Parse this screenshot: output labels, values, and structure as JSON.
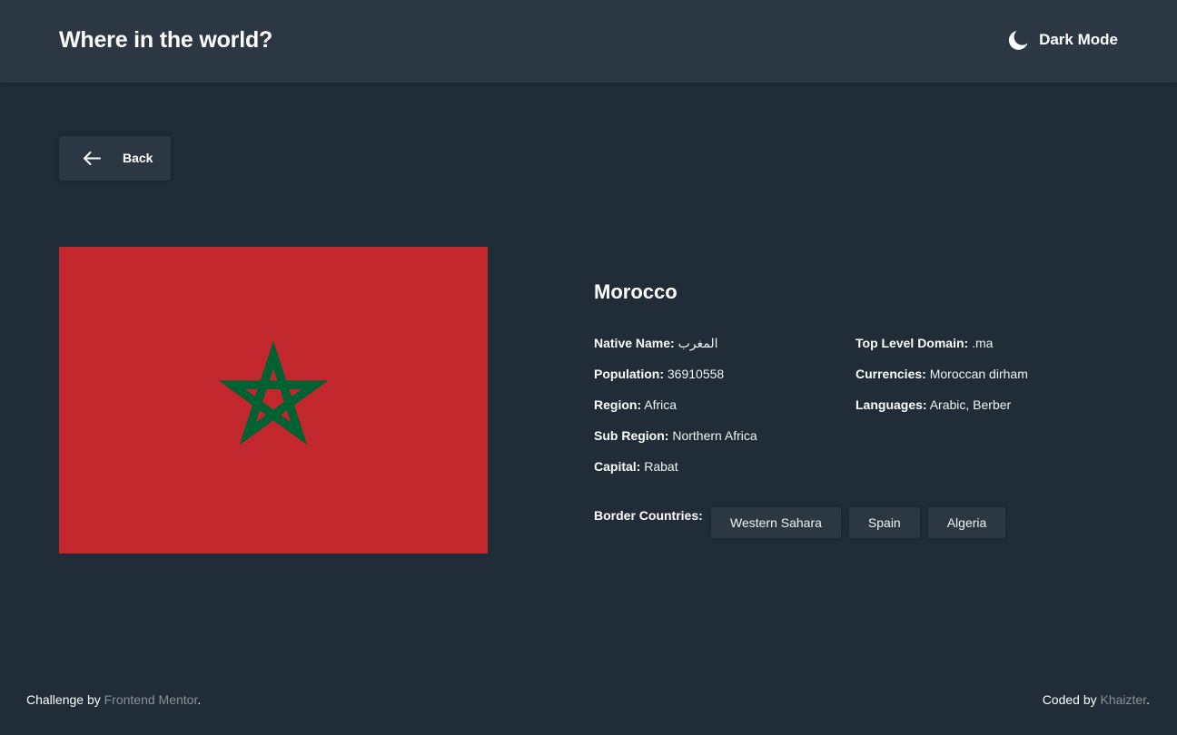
{
  "header": {
    "title": "Where in the world?",
    "theme_label": "Dark Mode",
    "theme_icon": "moon-icon"
  },
  "back_button": {
    "label": "Back",
    "icon": "arrow-left-icon"
  },
  "country": {
    "name": "Morocco",
    "flag_colors": {
      "field": "#c1272d",
      "star": "#006233"
    },
    "left_details": [
      {
        "label": "Native Name:",
        "value": "المغرب"
      },
      {
        "label": "Population:",
        "value": "36910558"
      },
      {
        "label": "Region:",
        "value": "Africa"
      },
      {
        "label": "Sub Region:",
        "value": "Northern Africa"
      },
      {
        "label": "Capital:",
        "value": "Rabat"
      }
    ],
    "right_details": [
      {
        "label": "Top Level Domain:",
        "value": ".ma"
      },
      {
        "label": "Currencies:",
        "value": "Moroccan dirham"
      },
      {
        "label": "Languages:",
        "value": "Arabic, Berber"
      }
    ],
    "border_label": "Border Countries:",
    "borders": [
      "Western Sahara",
      "Spain",
      "Algeria"
    ]
  },
  "footer": {
    "challenge_prefix": "Challenge by ",
    "challenge_link": "Frontend Mentor",
    "challenge_suffix": ".",
    "coded_prefix": "Coded by ",
    "coded_link": "Khaizter",
    "coded_suffix": "."
  },
  "colors": {
    "background": "#202c37",
    "surface": "#2b3743",
    "text": "#ffffff",
    "muted_link": "#8a9199"
  }
}
